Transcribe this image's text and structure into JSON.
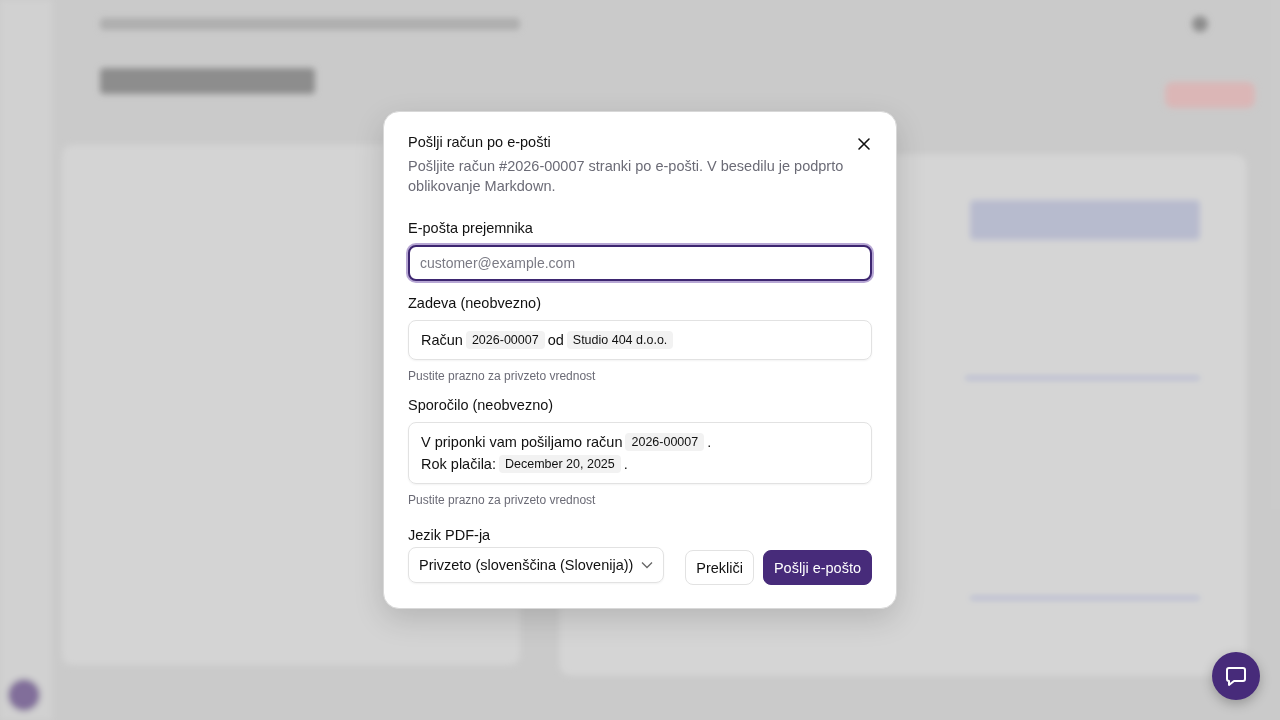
{
  "dialog": {
    "title": "Pošlji račun po e-pošti",
    "description": "Pošljite račun #2026-00007 stranki po e-pošti. V besedilu je podprto oblikovanje Markdown.",
    "fields": [
      {
        "kind": "input",
        "label": "E-pošta prejemnika",
        "placeholder": "customer@example.com",
        "focused": true
      },
      {
        "kind": "rich",
        "label": "Zadeva (neobvezno)",
        "lines": [
          [
            {
              "kind": "text",
              "text": "Račun"
            },
            {
              "kind": "tag",
              "text": "2026-00007"
            },
            {
              "kind": "text",
              "text": "od"
            },
            {
              "kind": "tag",
              "text": "Studio 404 d.o.o."
            }
          ]
        ],
        "hint": "Pustite prazno za privzeto vrednost"
      },
      {
        "kind": "rich",
        "label": "Sporočilo (neobvezno)",
        "lines": [
          [
            {
              "kind": "text",
              "text": "V priponki vam pošiljamo račun"
            },
            {
              "kind": "tag",
              "text": "2026-00007"
            },
            {
              "kind": "text",
              "text": "."
            }
          ],
          [
            {
              "kind": "text",
              "text": "Rok plačila:"
            },
            {
              "kind": "tag",
              "text": "December 20, 2025"
            },
            {
              "kind": "text",
              "text": "."
            }
          ]
        ],
        "hint": "Pustite prazno za privzeto vrednost"
      }
    ],
    "language": {
      "label": "Jezik PDF-ja",
      "value": "Privzeto (slovenščina (Slovenija))"
    },
    "buttons": [
      {
        "kind": "secondary",
        "label": "Prekliči"
      },
      {
        "kind": "primary",
        "label": "Pošlji e-pošto"
      }
    ]
  }
}
